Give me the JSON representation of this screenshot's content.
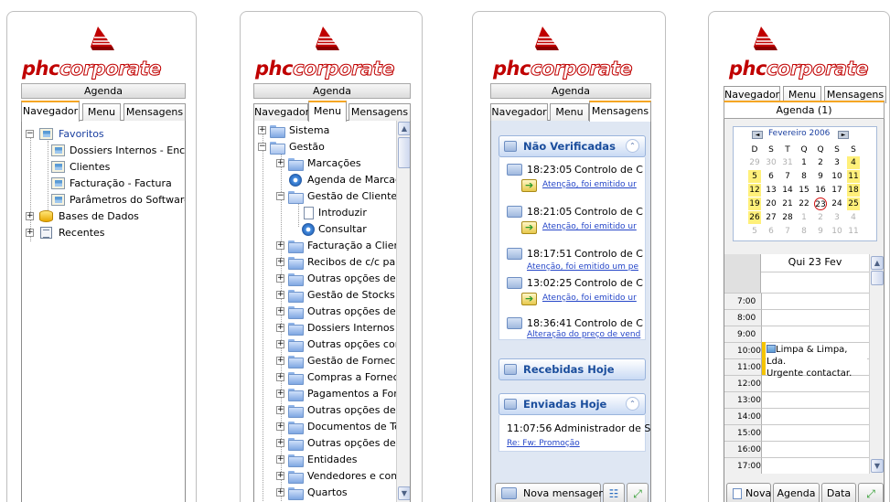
{
  "logo": {
    "part1": "phc",
    "part2": "corporate"
  },
  "panel1": {
    "agenda": "Agenda",
    "tabs": [
      "Navegador",
      "Menu",
      "Mensagens"
    ],
    "tree": {
      "favoritos": "Favoritos",
      "items": [
        "Dossiers Internos - Encom",
        "Clientes",
        "Facturação - Factura",
        "Parâmetros do Software"
      ],
      "bases": "Bases de Dados",
      "recentes": "Recentes"
    }
  },
  "panel2": {
    "agenda": "Agenda",
    "tabs": [
      "Navegador",
      "Menu",
      "Mensagens"
    ],
    "tree": {
      "sistema": "Sistema",
      "gestao": "Gestão",
      "marcacoes": "Marcações",
      "agenda_marcacoes": "Agenda de Marcações",
      "gestao_clientes": "Gestão de Clientes",
      "introduzir": "Introduzir",
      "consultar": "Consultar",
      "folders": [
        "Facturação a Clientes",
        "Recibos de c/c para C",
        "Outras opções de clie",
        "Gestão de Stocks",
        "Outras opções de Sto",
        "Dossiers Internos",
        "Outras opções com d",
        "Gestão de Fornecedo",
        "Compras a Fornecedo",
        "Pagamentos a Fornec",
        "Outras opções de for",
        "Documentos de Tesou",
        "Outras opções de Tes",
        "Entidades",
        "Vendedores e comissõ",
        "Quartos"
      ]
    }
  },
  "panel3": {
    "agenda": "Agenda",
    "tabs": [
      "Navegador",
      "Menu",
      "Mensagens"
    ],
    "nao_verificadas": "Não Verificadas",
    "messages": [
      {
        "time": "18:23:05",
        "title": "Controlo de C",
        "link": "Atenção, foi emitido ur"
      },
      {
        "time": "18:21:05",
        "title": "Controlo de C",
        "link": "Atenção, foi emitido ur"
      },
      {
        "time": "18:17:51",
        "title": "Controlo de C",
        "link": "Atenção, foi emitido um pe"
      },
      {
        "time": "13:02:25",
        "title": "Controlo de C",
        "link": "Atenção, foi emitido ur"
      },
      {
        "time": "18:36:41",
        "title": "Controlo de C",
        "link": "Alteração do preço de vend"
      }
    ],
    "recebidas": "Recebidas Hoje",
    "enviadas": "Enviadas Hoje",
    "enviada": {
      "time": "11:07:56",
      "title": "Administrador de S",
      "link": "Re: Fw: Promoção"
    },
    "nova_mensagem": "Nova mensagem"
  },
  "panel4": {
    "tabs": [
      "Navegador",
      "Menu",
      "Mensagens"
    ],
    "agenda_title": "Agenda (1)",
    "calendar": {
      "month": "Fevereiro 2006",
      "weekdays": [
        "D",
        "S",
        "T",
        "Q",
        "Q",
        "S",
        "S"
      ],
      "weeks": [
        [
          "29",
          "30",
          "31",
          "1",
          "2",
          "3",
          "4"
        ],
        [
          "5",
          "6",
          "7",
          "8",
          "9",
          "10",
          "11"
        ],
        [
          "12",
          "13",
          "14",
          "15",
          "16",
          "17",
          "18"
        ],
        [
          "19",
          "20",
          "21",
          "22",
          "23",
          "24",
          "25"
        ],
        [
          "26",
          "27",
          "28",
          "1",
          "2",
          "3",
          "4"
        ],
        [
          "5",
          "6",
          "7",
          "8",
          "9",
          "10",
          "11"
        ]
      ]
    },
    "day_header": "Qui 23 Fev",
    "hours": [
      "7:00",
      "8:00",
      "9:00",
      "10:00",
      "11:00",
      "12:00",
      "13:00",
      "14:00",
      "15:00",
      "16:00",
      "17:00"
    ],
    "event": {
      "line1": "Limpa & Limpa, Lda.",
      "line2": "Urgente contactar."
    },
    "buttons": {
      "nova": "Nova",
      "agenda": "Agenda",
      "data": "Data"
    }
  }
}
